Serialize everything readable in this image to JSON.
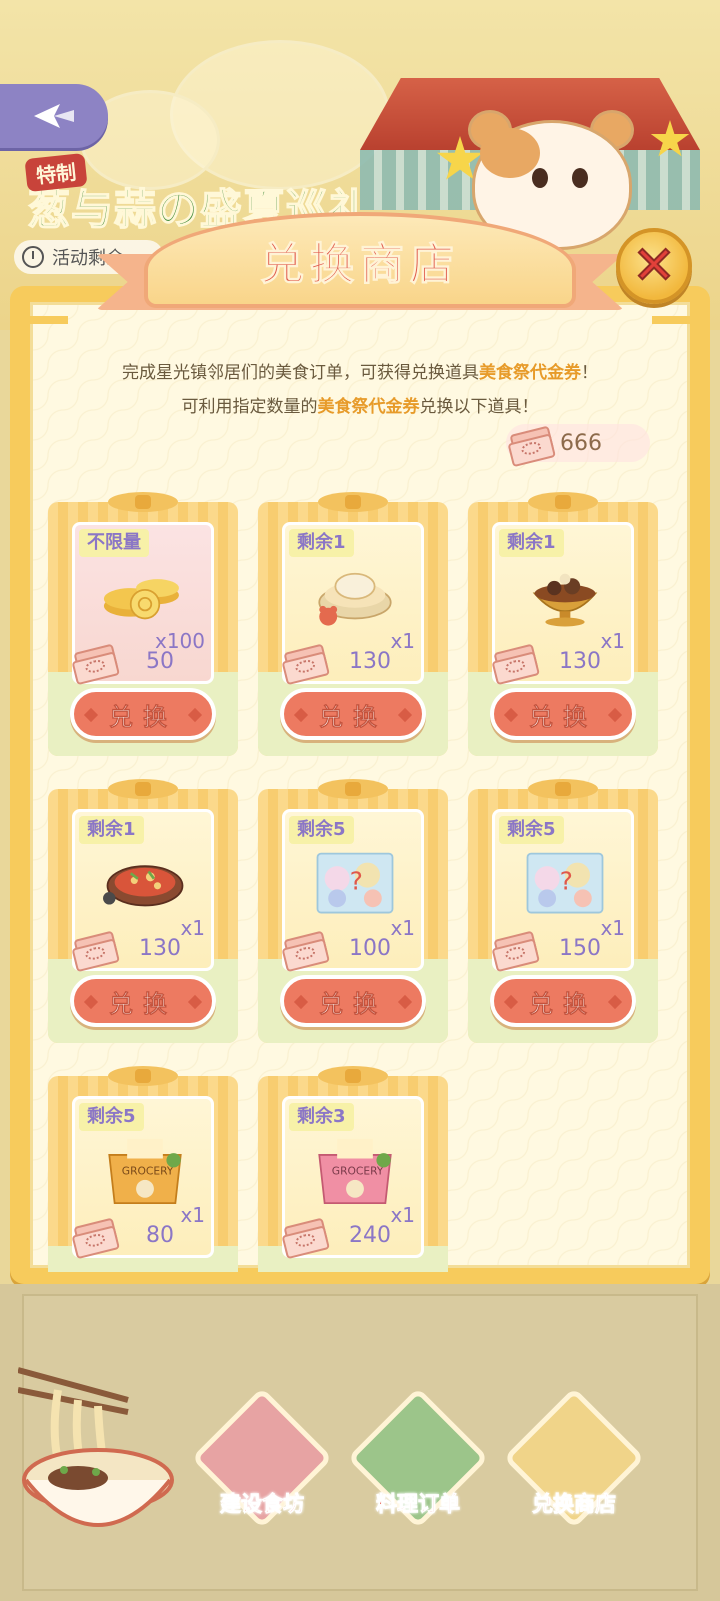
{
  "event": {
    "tag": "特制",
    "title": "葱与蒜の盛夏巡礼",
    "timer_label": "活动剩余"
  },
  "shop": {
    "title": "兑换商店",
    "close_symbol": "✕",
    "description_parts": [
      "完成星光镇邻居们的美食订单，可获得兑换道具",
      "美食祭代金券",
      "！可利用指定数量的",
      "美食祭代金券",
      "兑换以下道具！"
    ],
    "balance": "666",
    "exchange_label": "兑换"
  },
  "items": [
    {
      "limit": "不限量",
      "qty": "x100",
      "price": "50",
      "art": "gold-coins-icon",
      "panel": "pink",
      "has_button": true
    },
    {
      "limit": "剩余1",
      "qty": "x1",
      "price": "130",
      "art": "crab-dish-icon",
      "panel": "yellow",
      "has_button": true
    },
    {
      "limit": "剩余1",
      "qty": "x1",
      "price": "130",
      "art": "hotpot-dish-icon",
      "panel": "yellow",
      "has_button": true
    },
    {
      "limit": "剩余1",
      "qty": "x1",
      "price": "130",
      "art": "stew-plate-icon",
      "panel": "yellow",
      "has_button": true
    },
    {
      "limit": "剩余5",
      "qty": "x1",
      "price": "100",
      "art": "sticker-pack-icon",
      "panel": "yellow",
      "has_button": true
    },
    {
      "limit": "剩余5",
      "qty": "x1",
      "price": "150",
      "art": "sticker-pack-icon",
      "panel": "yellow",
      "has_button": true
    },
    {
      "limit": "剩余5",
      "qty": "x1",
      "price": "80",
      "art": "grocery-bag-orange-icon",
      "panel": "yellow",
      "has_button": false
    },
    {
      "limit": "剩余3",
      "qty": "x1",
      "price": "240",
      "art": "grocery-bag-pink-icon",
      "panel": "yellow",
      "has_button": false
    }
  ],
  "nav": [
    {
      "label": "建设食坊",
      "color": "#e7a3a3",
      "icon": "chef-hat-icon"
    },
    {
      "label": "料理订单",
      "color": "#9cc58a",
      "icon": "order-clipboard-icon"
    },
    {
      "label": "兑换商店",
      "color": "#f0d489",
      "icon": "shop-stall-icon"
    }
  ],
  "colors": {
    "accent": "#e0574a",
    "price_text": "#8b76c6",
    "button": "#ed7a61",
    "highlight": "#e79b2a"
  }
}
